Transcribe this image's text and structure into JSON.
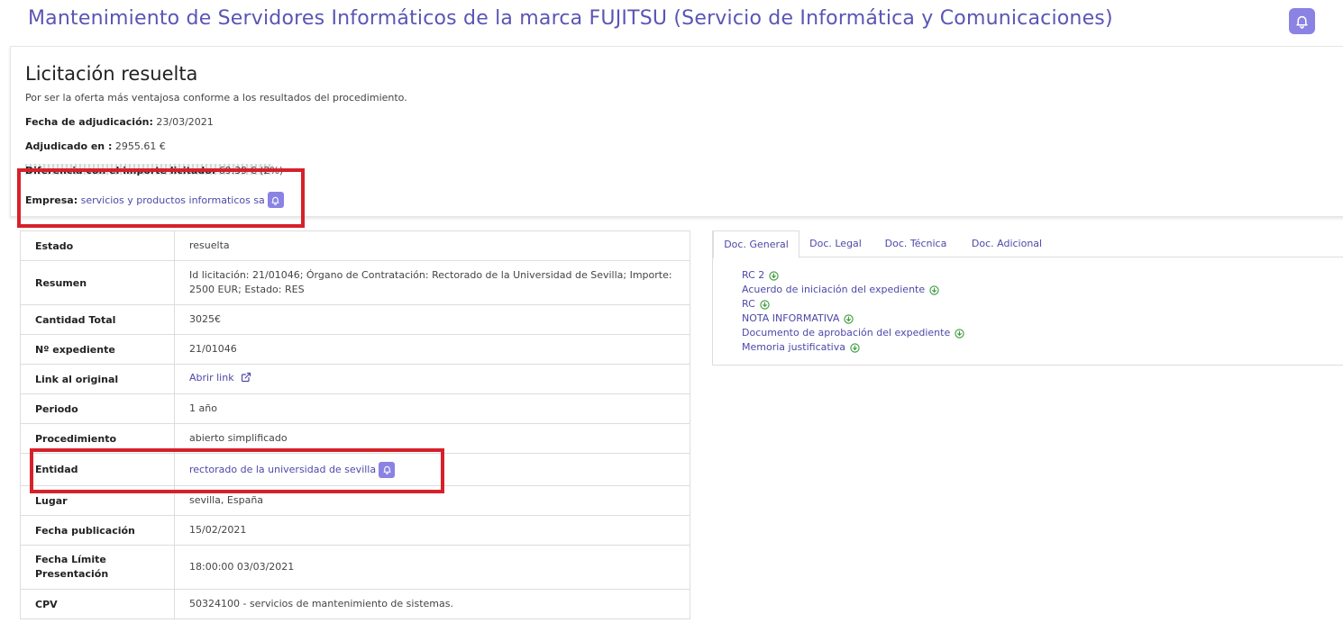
{
  "header": {
    "title": "Mantenimiento de Servidores Informáticos de la marca FUJITSU (Servicio de Informática y Comunicaciones)",
    "bell_icon": "bell-icon"
  },
  "award": {
    "title": "Licitación resuelta",
    "subtitle": "Por ser la oferta más ventajosa conforme a los resultados del procedimiento.",
    "fecha_label": "Fecha de adjudicación:",
    "fecha_value": "23/03/2021",
    "adjudicado_label": "Adjudicado en :",
    "adjudicado_value": "2955.61 €",
    "diferencia_label": "Diferencia con el importe licitado:",
    "diferencia_value": "69.39 € (2%)",
    "empresa_label": "Empresa:",
    "empresa_value": "servicios y productos informaticos sa"
  },
  "details": {
    "estado_label": "Estado",
    "estado_value": "resuelta",
    "resumen_label": "Resumen",
    "resumen_value_1": "Id licitación: 21/01046; Órgano de Contratación: Rectorado de la Universidad de Sevilla; Importe:",
    "resumen_value_2": "2500 EUR; Estado: RES",
    "cantidad_label": "Cantidad Total",
    "cantidad_value": "3025€",
    "expediente_label": "Nº expediente",
    "expediente_value": "21/01046",
    "link_label": "Link al original",
    "link_value": "Abrir link",
    "periodo_label": "Periodo",
    "periodo_value": "1 año",
    "procedimiento_label": "Procedimiento",
    "procedimiento_value": "abierto simplificado",
    "entidad_label": "Entidad",
    "entidad_value": "rectorado de la universidad de sevilla",
    "lugar_label": "Lugar",
    "lugar_value": "sevilla, España",
    "fecha_pub_label": "Fecha publicación",
    "fecha_pub_value": "15/02/2021",
    "fecha_lim_label_1": "Fecha Límite",
    "fecha_lim_label_2": "Presentación",
    "fecha_lim_value": "18:00:00 03/03/2021",
    "cpv_label": "CPV",
    "cpv_value": "50324100 - servicios de mantenimiento de sistemas."
  },
  "docs": {
    "tabs": [
      "Doc. General",
      "Doc. Legal",
      "Doc. Técnica",
      "Doc. Adicional"
    ],
    "items": [
      "RC 2",
      "Acuerdo de iniciación del expediente",
      "RC",
      "NOTA INFORMATIVA",
      "Documento de aprobación del expediente",
      "Memoria justificativa"
    ]
  },
  "colors": {
    "accent": "#5a55b5",
    "bell_bg": "#8a83e4",
    "highlight": "#d6212a",
    "download": "#3a9a3a"
  }
}
